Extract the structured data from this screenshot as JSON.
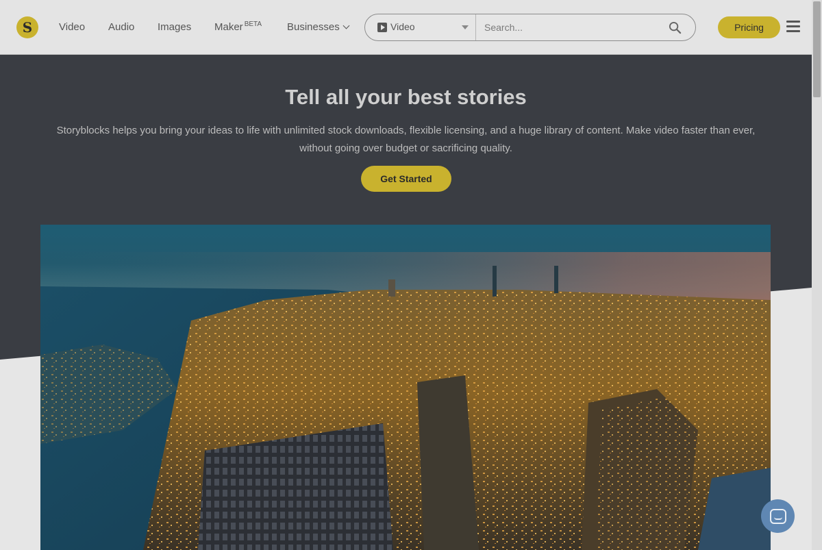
{
  "header": {
    "logo_letter": "S",
    "nav": [
      {
        "label": "Video"
      },
      {
        "label": "Audio"
      },
      {
        "label": "Images"
      },
      {
        "label": "Maker",
        "badge": "BETA"
      },
      {
        "label": "Businesses"
      }
    ],
    "search": {
      "type_label": "Video",
      "placeholder": "Search..."
    },
    "pricing_label": "Pricing"
  },
  "hero": {
    "title": "Tell all your best stories",
    "subtitle": "Storyblocks helps you bring your ideas to life with unlimited stock downloads, flexible licensing, and a huge library of content. Make video faster than ever, without going over budget or sacrificing quality.",
    "cta_label": "Get Started"
  },
  "colors": {
    "accent": "#c9b22e",
    "hero_bg": "#3a3d43",
    "chat": "#5f87b3"
  }
}
